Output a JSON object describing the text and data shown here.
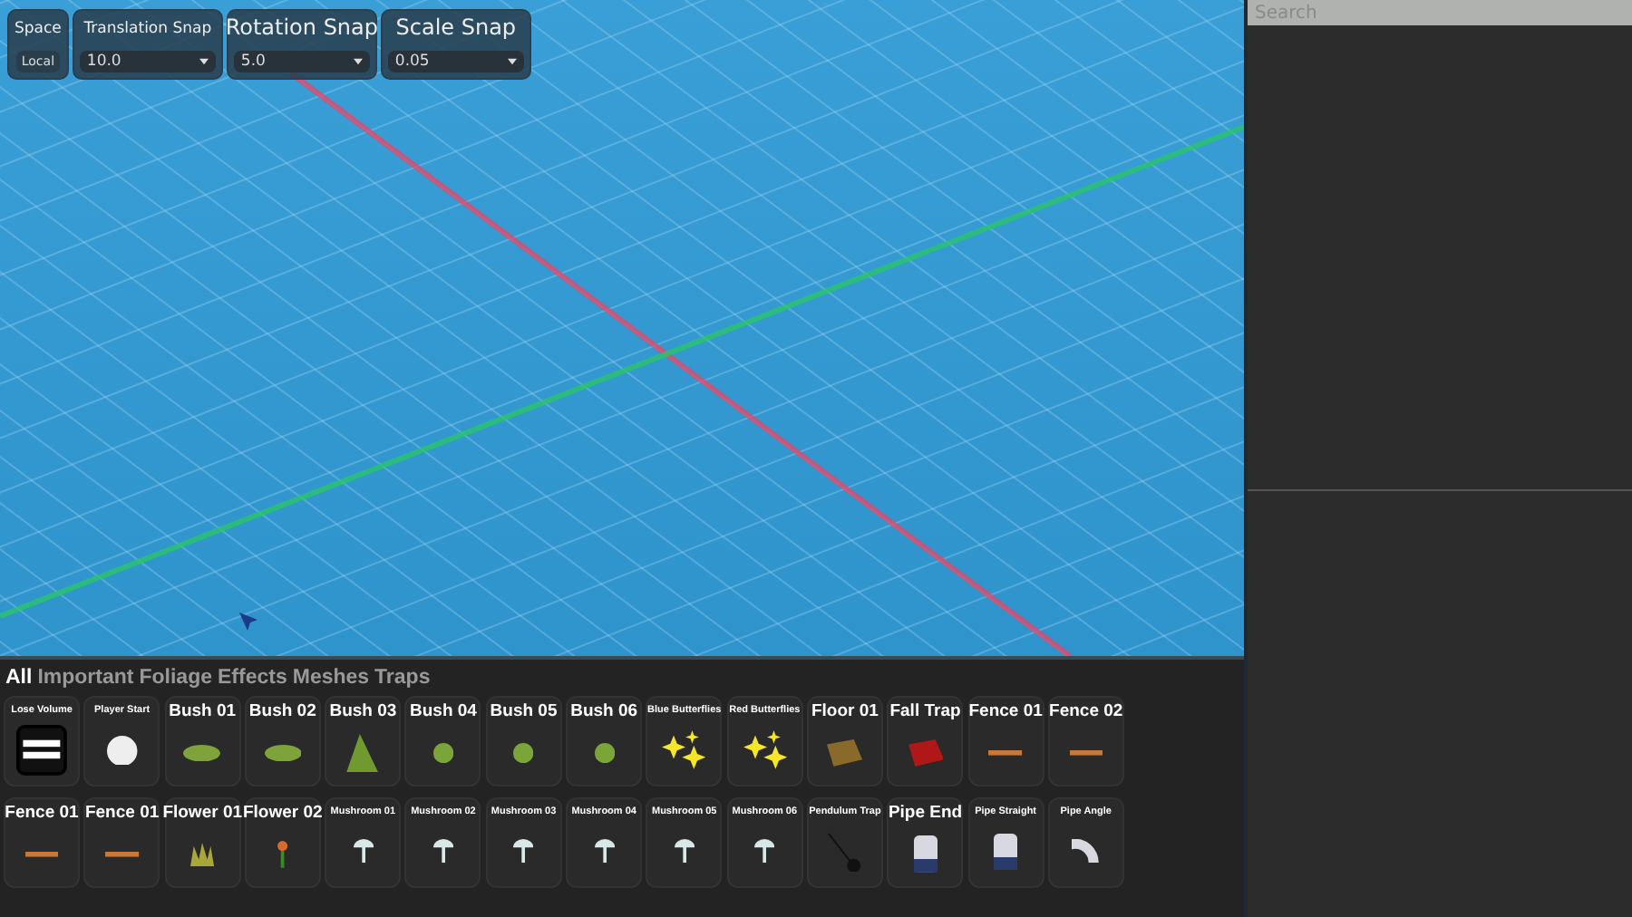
{
  "toolbar": {
    "space": {
      "label": "Space",
      "value": "Local"
    },
    "snaps": [
      {
        "label": "Translation Snap",
        "value": "10.0"
      },
      {
        "label": "Rotation Snap",
        "value": "5.0"
      },
      {
        "label": "Scale Snap",
        "value": "0.05"
      }
    ]
  },
  "search": {
    "placeholder": "Search"
  },
  "tabs": [
    {
      "label": "All",
      "selected": true
    },
    {
      "label": "Important",
      "selected": false
    },
    {
      "label": "Foliage",
      "selected": false
    },
    {
      "label": "Effects",
      "selected": false
    },
    {
      "label": "Meshes",
      "selected": false
    },
    {
      "label": "Traps",
      "selected": false
    }
  ],
  "assets": [
    {
      "label": "Lose Volume",
      "kind": "badge"
    },
    {
      "label": "Player Start",
      "kind": "ball"
    },
    {
      "label": "Bush 01",
      "kind": "bush"
    },
    {
      "label": "Bush 02",
      "kind": "bush"
    },
    {
      "label": "Bush 03",
      "kind": "cone"
    },
    {
      "label": "Bush 04",
      "kind": "blob"
    },
    {
      "label": "Bush 05",
      "kind": "blob"
    },
    {
      "label": "Bush 06",
      "kind": "blob"
    },
    {
      "label": "Blue Butterflies",
      "kind": "sparkles"
    },
    {
      "label": "Red Butterflies",
      "kind": "sparkles"
    },
    {
      "label": "Floor 01",
      "kind": "slab"
    },
    {
      "label": "Fall Trap",
      "kind": "trapslab"
    },
    {
      "label": "Fence 01",
      "kind": "rail"
    },
    {
      "label": "Fence 02",
      "kind": "rail"
    },
    {
      "label": "Fence 01",
      "kind": "rail"
    },
    {
      "label": "Fence 01",
      "kind": "rail"
    },
    {
      "label": "Flower 01",
      "kind": "grass"
    },
    {
      "label": "Flower 02",
      "kind": "flower"
    },
    {
      "label": "Mushroom 01",
      "kind": "mushroom"
    },
    {
      "label": "Mushroom 02",
      "kind": "mushroom"
    },
    {
      "label": "Mushroom 03",
      "kind": "mushroom"
    },
    {
      "label": "Mushroom 04",
      "kind": "mushroom"
    },
    {
      "label": "Mushroom 05",
      "kind": "mushroom"
    },
    {
      "label": "Mushroom 06",
      "kind": "mushroom"
    },
    {
      "label": "Pendulum Trap",
      "kind": "pendulum"
    },
    {
      "label": "Pipe End",
      "kind": "pipe"
    },
    {
      "label": "Pipe Straight",
      "kind": "pipe"
    },
    {
      "label": "Pipe Angle",
      "kind": "elbow"
    }
  ]
}
